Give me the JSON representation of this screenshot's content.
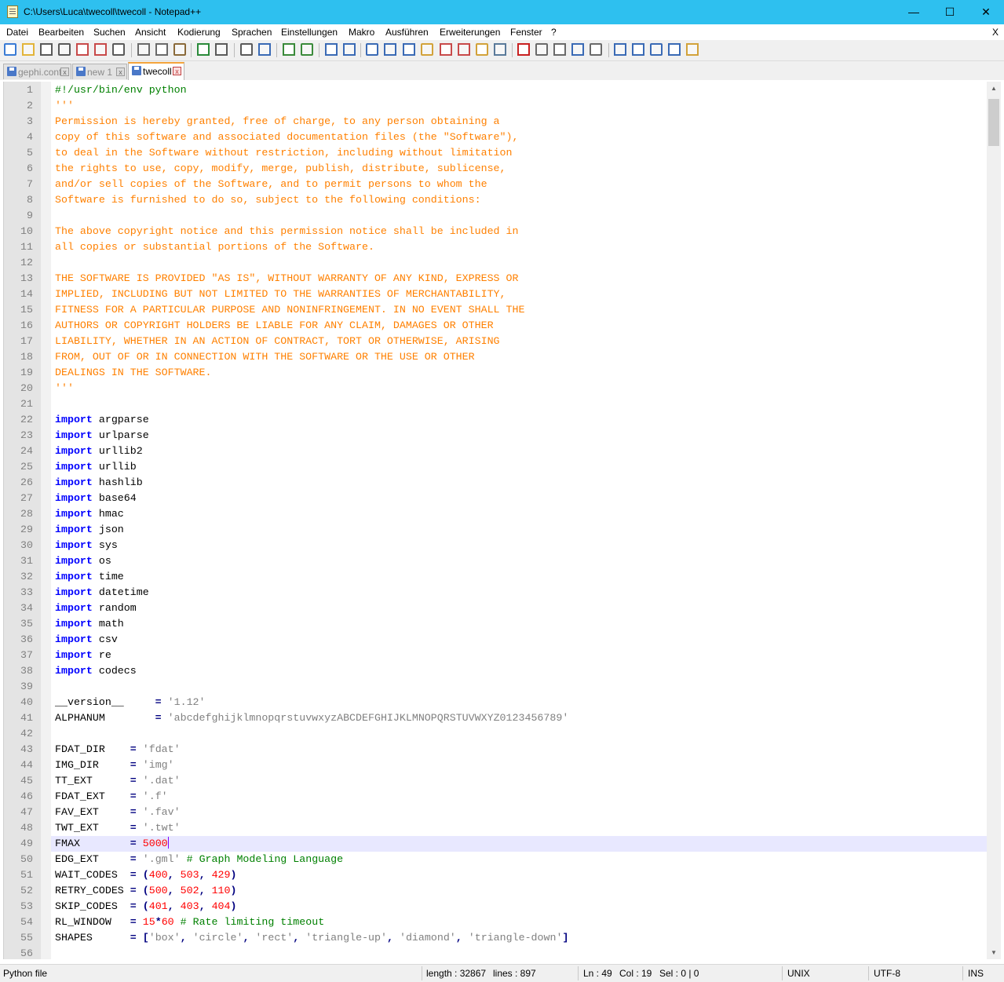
{
  "window": {
    "title": "C:\\Users\\Luca\\twecoll\\twecoll - Notepad++",
    "minimize_glyph": "—",
    "maximize_glyph": "☐",
    "close_glyph": "✕"
  },
  "menu": {
    "items": [
      "Datei",
      "Bearbeiten",
      "Suchen",
      "Ansicht",
      "Kodierung",
      "Sprachen",
      "Einstellungen",
      "Makro",
      "Ausführen",
      "Erweiterungen",
      "Fenster",
      "?"
    ],
    "close_glyph": "X"
  },
  "toolbar": {
    "icons": [
      "new-file-icon",
      "open-file-icon",
      "save-icon",
      "save-all-icon",
      "close-icon",
      "close-all-icon",
      "print-icon",
      "cut-icon",
      "copy-icon",
      "paste-icon",
      "undo-icon",
      "redo-icon",
      "find-icon",
      "replace-icon",
      "zoom-in-icon",
      "zoom-out-icon",
      "sync-vertical-icon",
      "sync-horizontal-icon",
      "word-wrap-icon",
      "show-all-chars-icon",
      "indent-guide-icon",
      "language-icon",
      "doc-map-icon",
      "function-list-icon",
      "folder-workspace-icon",
      "monitoring-icon",
      "record-macro-icon",
      "stop-record-icon",
      "play-macro-icon",
      "run-macro-multiple-icon",
      "save-macro-icon",
      "trim-icon",
      "move-up-icon",
      "move-down-icon",
      "sort-icon",
      "plugin-icon"
    ]
  },
  "tabs": [
    {
      "label": "gephi.conf",
      "close_glyph": "x",
      "active": false
    },
    {
      "label": "new 1",
      "close_glyph": "x",
      "active": false
    },
    {
      "label": "twecoll",
      "close_glyph": "x",
      "active": true
    }
  ],
  "editor": {
    "current_line": 49,
    "lines": [
      [
        [
          "cmt",
          "#!/usr/bin/env python"
        ]
      ],
      [
        [
          "doc",
          "'''"
        ]
      ],
      [
        [
          "doc",
          "Permission is hereby granted, free of charge, to any person obtaining a"
        ]
      ],
      [
        [
          "doc",
          "copy of this software and associated documentation files (the \"Software\"),"
        ]
      ],
      [
        [
          "doc",
          "to deal in the Software without restriction, including without limitation"
        ]
      ],
      [
        [
          "doc",
          "the rights to use, copy, modify, merge, publish, distribute, sublicense,"
        ]
      ],
      [
        [
          "doc",
          "and/or sell copies of the Software, and to permit persons to whom the"
        ]
      ],
      [
        [
          "doc",
          "Software is furnished to do so, subject to the following conditions:"
        ]
      ],
      [],
      [
        [
          "doc",
          "The above copyright notice and this permission notice shall be included in"
        ]
      ],
      [
        [
          "doc",
          "all copies or substantial portions of the Software."
        ]
      ],
      [],
      [
        [
          "doc",
          "THE SOFTWARE IS PROVIDED \"AS IS\", WITHOUT WARRANTY OF ANY KIND, EXPRESS OR"
        ]
      ],
      [
        [
          "doc",
          "IMPLIED, INCLUDING BUT NOT LIMITED TO THE WARRANTIES OF MERCHANTABILITY,"
        ]
      ],
      [
        [
          "doc",
          "FITNESS FOR A PARTICULAR PURPOSE AND NONINFRINGEMENT. IN NO EVENT SHALL THE"
        ]
      ],
      [
        [
          "doc",
          "AUTHORS OR COPYRIGHT HOLDERS BE LIABLE FOR ANY CLAIM, DAMAGES OR OTHER"
        ]
      ],
      [
        [
          "doc",
          "LIABILITY, WHETHER IN AN ACTION OF CONTRACT, TORT OR OTHERWISE, ARISING"
        ]
      ],
      [
        [
          "doc",
          "FROM, OUT OF OR IN CONNECTION WITH THE SOFTWARE OR THE USE OR OTHER"
        ]
      ],
      [
        [
          "doc",
          "DEALINGS IN THE SOFTWARE."
        ]
      ],
      [
        [
          "doc",
          "'''"
        ]
      ],
      [],
      [
        [
          "kw",
          "import"
        ],
        [
          "plain",
          " argparse"
        ]
      ],
      [
        [
          "kw",
          "import"
        ],
        [
          "plain",
          " urlparse"
        ]
      ],
      [
        [
          "kw",
          "import"
        ],
        [
          "plain",
          " urllib2"
        ]
      ],
      [
        [
          "kw",
          "import"
        ],
        [
          "plain",
          " urllib"
        ]
      ],
      [
        [
          "kw",
          "import"
        ],
        [
          "plain",
          " hashlib"
        ]
      ],
      [
        [
          "kw",
          "import"
        ],
        [
          "plain",
          " base64"
        ]
      ],
      [
        [
          "kw",
          "import"
        ],
        [
          "plain",
          " hmac"
        ]
      ],
      [
        [
          "kw",
          "import"
        ],
        [
          "plain",
          " json"
        ]
      ],
      [
        [
          "kw",
          "import"
        ],
        [
          "plain",
          " sys"
        ]
      ],
      [
        [
          "kw",
          "import"
        ],
        [
          "plain",
          " os"
        ]
      ],
      [
        [
          "kw",
          "import"
        ],
        [
          "plain",
          " time"
        ]
      ],
      [
        [
          "kw",
          "import"
        ],
        [
          "plain",
          " datetime"
        ]
      ],
      [
        [
          "kw",
          "import"
        ],
        [
          "plain",
          " random"
        ]
      ],
      [
        [
          "kw",
          "import"
        ],
        [
          "plain",
          " math"
        ]
      ],
      [
        [
          "kw",
          "import"
        ],
        [
          "plain",
          " csv"
        ]
      ],
      [
        [
          "kw",
          "import"
        ],
        [
          "plain",
          " re"
        ]
      ],
      [
        [
          "kw",
          "import"
        ],
        [
          "plain",
          " codecs"
        ]
      ],
      [],
      [
        [
          "plain",
          "__version__     "
        ],
        [
          "op",
          "="
        ],
        [
          "plain",
          " "
        ],
        [
          "str",
          "'1.12'"
        ]
      ],
      [
        [
          "plain",
          "ALPHANUM        "
        ],
        [
          "op",
          "="
        ],
        [
          "plain",
          " "
        ],
        [
          "str",
          "'abcdefghijklmnopqrstuvwxyzABCDEFGHIJKLMNOPQRSTUVWXYZ0123456789'"
        ]
      ],
      [],
      [
        [
          "plain",
          "FDAT_DIR    "
        ],
        [
          "op",
          "="
        ],
        [
          "plain",
          " "
        ],
        [
          "str",
          "'fdat'"
        ]
      ],
      [
        [
          "plain",
          "IMG_DIR     "
        ],
        [
          "op",
          "="
        ],
        [
          "plain",
          " "
        ],
        [
          "str",
          "'img'"
        ]
      ],
      [
        [
          "plain",
          "TT_EXT      "
        ],
        [
          "op",
          "="
        ],
        [
          "plain",
          " "
        ],
        [
          "str",
          "'.dat'"
        ]
      ],
      [
        [
          "plain",
          "FDAT_EXT    "
        ],
        [
          "op",
          "="
        ],
        [
          "plain",
          " "
        ],
        [
          "str",
          "'.f'"
        ]
      ],
      [
        [
          "plain",
          "FAV_EXT     "
        ],
        [
          "op",
          "="
        ],
        [
          "plain",
          " "
        ],
        [
          "str",
          "'.fav'"
        ]
      ],
      [
        [
          "plain",
          "TWT_EXT     "
        ],
        [
          "op",
          "="
        ],
        [
          "plain",
          " "
        ],
        [
          "str",
          "'.twt'"
        ]
      ],
      [
        [
          "plain",
          "FMAX        "
        ],
        [
          "op",
          "="
        ],
        [
          "plain",
          " "
        ],
        [
          "num",
          "5000"
        ],
        [
          "caret",
          ""
        ]
      ],
      [
        [
          "plain",
          "EDG_EXT     "
        ],
        [
          "op",
          "="
        ],
        [
          "plain",
          " "
        ],
        [
          "str",
          "'.gml'"
        ],
        [
          "plain",
          " "
        ],
        [
          "cmt",
          "# Graph Modeling Language"
        ]
      ],
      [
        [
          "plain",
          "WAIT_CODES  "
        ],
        [
          "op",
          "="
        ],
        [
          "plain",
          " "
        ],
        [
          "op",
          "("
        ],
        [
          "num",
          "400"
        ],
        [
          "op",
          ","
        ],
        [
          "plain",
          " "
        ],
        [
          "num",
          "503"
        ],
        [
          "op",
          ","
        ],
        [
          "plain",
          " "
        ],
        [
          "num",
          "429"
        ],
        [
          "op",
          ")"
        ]
      ],
      [
        [
          "plain",
          "RETRY_CODES "
        ],
        [
          "op",
          "="
        ],
        [
          "plain",
          " "
        ],
        [
          "op",
          "("
        ],
        [
          "num",
          "500"
        ],
        [
          "op",
          ","
        ],
        [
          "plain",
          " "
        ],
        [
          "num",
          "502"
        ],
        [
          "op",
          ","
        ],
        [
          "plain",
          " "
        ],
        [
          "num",
          "110"
        ],
        [
          "op",
          ")"
        ]
      ],
      [
        [
          "plain",
          "SKIP_CODES  "
        ],
        [
          "op",
          "="
        ],
        [
          "plain",
          " "
        ],
        [
          "op",
          "("
        ],
        [
          "num",
          "401"
        ],
        [
          "op",
          ","
        ],
        [
          "plain",
          " "
        ],
        [
          "num",
          "403"
        ],
        [
          "op",
          ","
        ],
        [
          "plain",
          " "
        ],
        [
          "num",
          "404"
        ],
        [
          "op",
          ")"
        ]
      ],
      [
        [
          "plain",
          "RL_WINDOW   "
        ],
        [
          "op",
          "="
        ],
        [
          "plain",
          " "
        ],
        [
          "num",
          "15"
        ],
        [
          "op",
          "*"
        ],
        [
          "num",
          "60"
        ],
        [
          "plain",
          " "
        ],
        [
          "cmt",
          "# Rate limiting timeout"
        ]
      ],
      [
        [
          "plain",
          "SHAPES      "
        ],
        [
          "op",
          "="
        ],
        [
          "plain",
          " "
        ],
        [
          "op",
          "["
        ],
        [
          "str",
          "'box'"
        ],
        [
          "op",
          ","
        ],
        [
          "plain",
          " "
        ],
        [
          "str",
          "'circle'"
        ],
        [
          "op",
          ","
        ],
        [
          "plain",
          " "
        ],
        [
          "str",
          "'rect'"
        ],
        [
          "op",
          ","
        ],
        [
          "plain",
          " "
        ],
        [
          "str",
          "'triangle-up'"
        ],
        [
          "op",
          ","
        ],
        [
          "plain",
          " "
        ],
        [
          "str",
          "'diamond'"
        ],
        [
          "op",
          ","
        ],
        [
          "plain",
          " "
        ],
        [
          "str",
          "'triangle-down'"
        ],
        [
          "op",
          "]"
        ]
      ],
      []
    ]
  },
  "statusbar": {
    "file_type": "Python file",
    "length": "length : 32867",
    "lines": "lines : 897",
    "ln": "Ln : 49",
    "col": "Col : 19",
    "sel": "Sel : 0 | 0",
    "eol": "UNIX",
    "encoding": "UTF-8",
    "mode": "INS"
  },
  "scrollbar": {
    "up_glyph": "▲",
    "down_glyph": "▼"
  },
  "colors": {
    "titlebar": "#2ec0ef",
    "keyword": "#0000ff",
    "string": "#808080",
    "number": "#ff0000",
    "comment": "#008000",
    "docstring": "#ff8000",
    "current_line": "#e8e8ff"
  }
}
